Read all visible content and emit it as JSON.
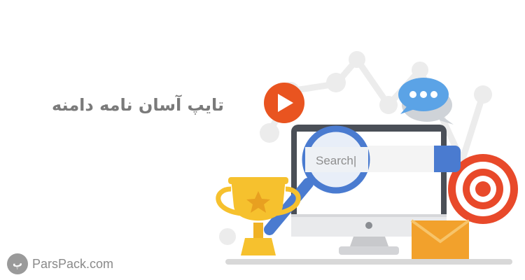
{
  "title": "تایپ آسان نامه دامنه",
  "brand": {
    "logo_glyph": "پ",
    "name": "ParsPack.com"
  },
  "search": {
    "placeholder": "Search|"
  },
  "icons": [
    "play-icon",
    "chat-icon",
    "target-icon",
    "trophy-icon",
    "magnifier-icon",
    "envelope-icon",
    "monitor-icon"
  ],
  "colors": {
    "play": "#E95420",
    "chat": "#5BA3E6",
    "target": "#E8492A",
    "trophy": "#F6C12E",
    "magnifier": "#4A7BD0",
    "envelope": "#F2A12C",
    "monitor_frame": "#4A4F57",
    "title": "#7a7a7a",
    "brand": "#8a8a8a"
  }
}
